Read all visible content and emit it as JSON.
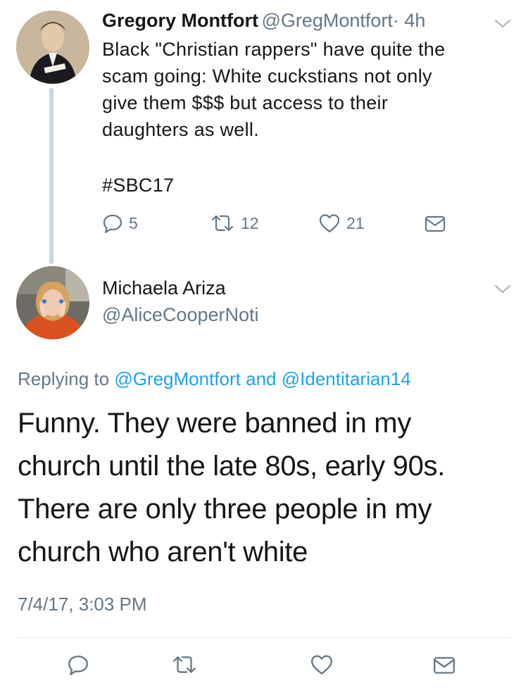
{
  "tweet1": {
    "name": "Gregory Montfort",
    "handle": "@GregMontfort",
    "time": "· 4h",
    "lines": [
      "Black \"Christian rappers\" have quite the",
      "scam going: White cuckstians not only",
      "give them $$$ but access to their",
      "daughters as well."
    ],
    "hashtag": "#SBC17",
    "replies": "5",
    "retweets": "12",
    "likes": "21"
  },
  "reply": {
    "name": "Michaela Ariza",
    "handle": "@AliceCooperNoti",
    "replying_prefix": "Replying to",
    "replying_user1": "@GregMontfort",
    "replying_and": "and",
    "replying_user2": "@Identitarian14",
    "lines": [
      "Funny. They were banned in my",
      "church until the late 80s, early 90s.",
      "There are only three people in my",
      "church who aren't white"
    ],
    "timestamp": "7/4/17, 3:03 PM"
  },
  "colors": {
    "link": "#1da1f2",
    "secondary": "#657786",
    "thread_line": "#ccd6dd"
  },
  "icons": [
    "reply-icon",
    "retweet-icon",
    "like-icon",
    "message-icon",
    "chevron-down-icon"
  ]
}
